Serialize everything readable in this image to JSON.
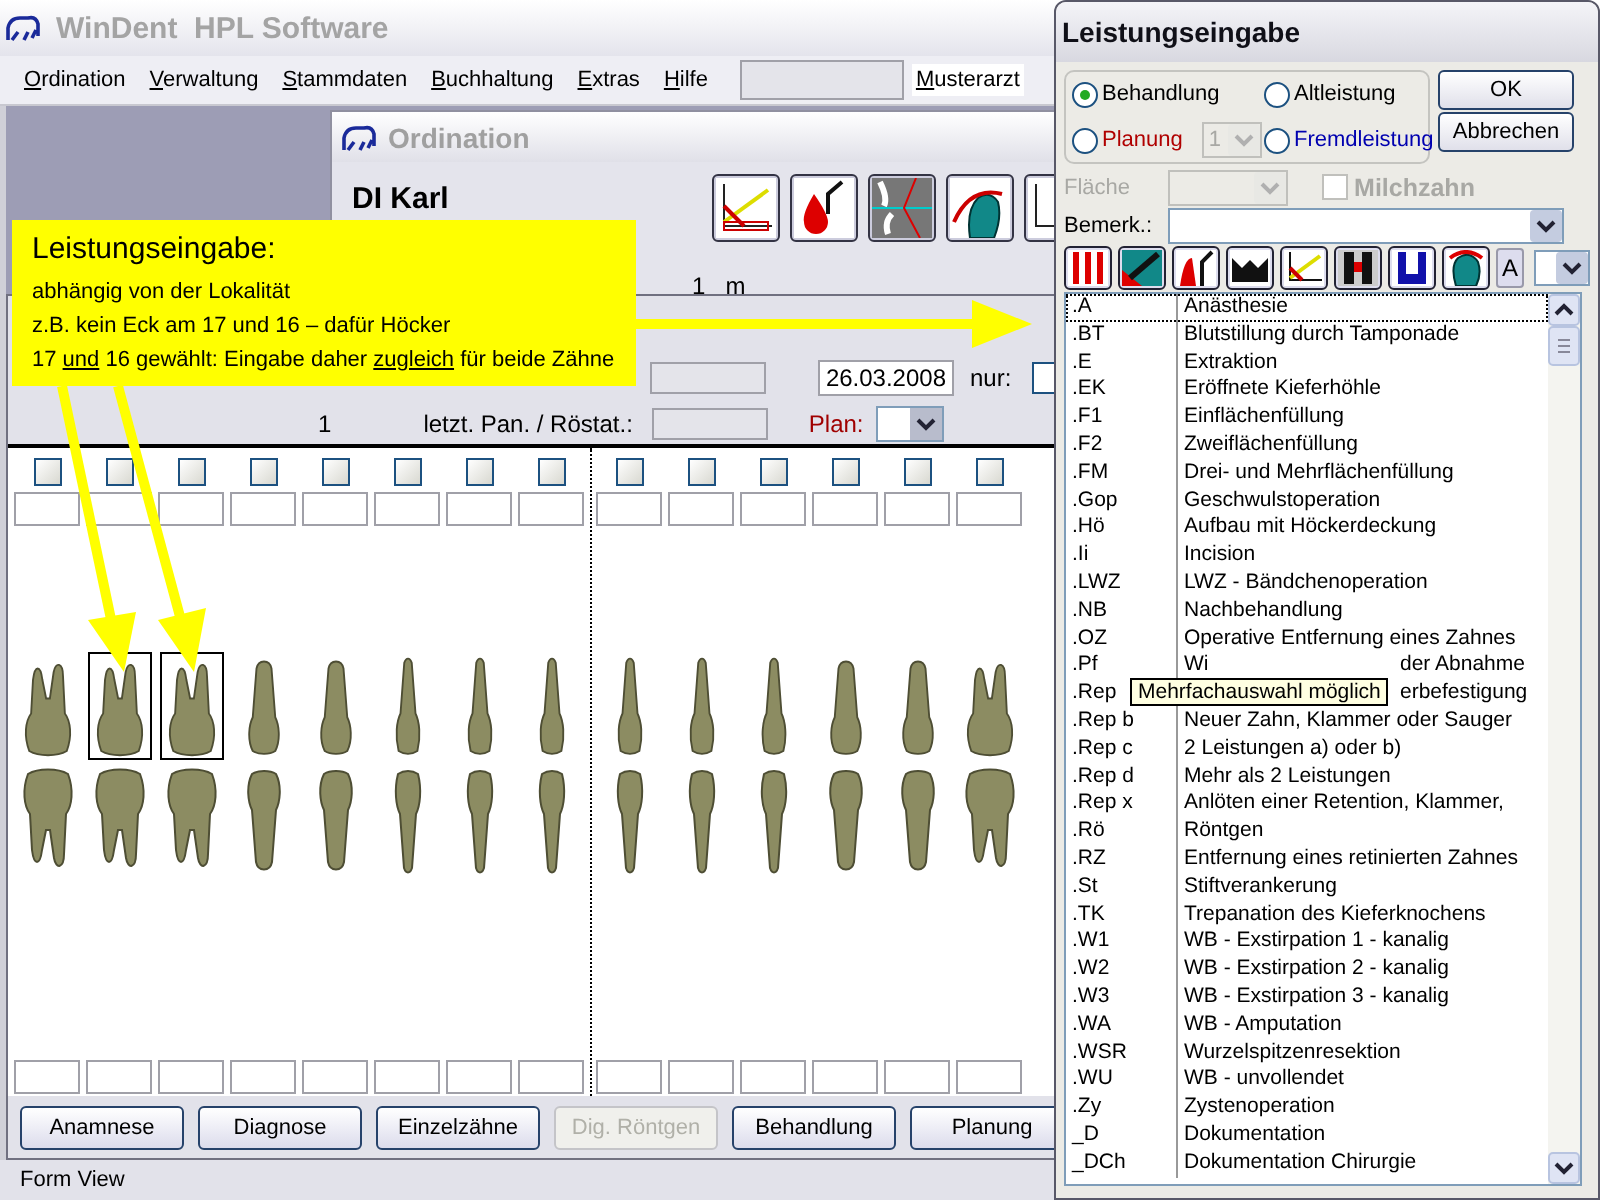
{
  "app": {
    "title": "WinDent  HPL Software",
    "menu": [
      "Ordination",
      "Verwaltung",
      "Stammdaten",
      "Buchhaltung",
      "Extras",
      "Hilfe"
    ],
    "user": "Musterarzt"
  },
  "ordination": {
    "title": "Ordination",
    "patient": "DI Karl",
    "info": [
      "1",
      "m"
    ]
  },
  "form": {
    "date": "26.03.2008",
    "only_label": "nur:",
    "count": "1",
    "xray_label": "letzt. Pan. / Röstat.:",
    "plan_label": "Plan:",
    "teeth": [
      {
        "kind": "molar",
        "selected": false,
        "checked": false
      },
      {
        "kind": "molar",
        "selected": true,
        "checked": false
      },
      {
        "kind": "molar",
        "selected": true,
        "checked": false
      },
      {
        "kind": "premolar",
        "selected": false,
        "checked": false
      },
      {
        "kind": "premolar",
        "selected": false,
        "checked": false
      },
      {
        "kind": "front",
        "selected": false,
        "checked": false
      },
      {
        "kind": "front",
        "selected": false,
        "checked": false
      },
      {
        "kind": "front",
        "selected": false,
        "checked": false
      },
      {
        "kind": "front",
        "selected": false,
        "checked": false
      },
      {
        "kind": "front",
        "selected": false,
        "checked": false
      },
      {
        "kind": "front",
        "selected": false,
        "checked": false
      },
      {
        "kind": "premolar",
        "selected": false,
        "checked": false
      },
      {
        "kind": "premolar",
        "selected": false,
        "checked": false
      },
      {
        "kind": "molar",
        "selected": false,
        "checked": false
      }
    ],
    "only_checked": false,
    "buttons": [
      {
        "label": "Anamnese",
        "disabled": false
      },
      {
        "label": "Diagnose",
        "disabled": false
      },
      {
        "label": "Einzelzähne",
        "disabled": false
      },
      {
        "label": "Dig. Röntgen",
        "disabled": true
      },
      {
        "label": "Behandlung",
        "disabled": false
      },
      {
        "label": "Planung",
        "disabled": false
      }
    ]
  },
  "note": {
    "title": "Leistungseingabe:",
    "lines": [
      [
        {
          "text": "abhängig von der Lokalität",
          "underline": false
        }
      ],
      [
        {
          "text": "z.B. kein Eck am 17 und 16 – dafür Höcker",
          "underline": false
        }
      ],
      [
        {
          "text": "17 ",
          "underline": false
        },
        {
          "text": "und",
          "underline": true
        },
        {
          "text": " 16 gewählt: Eingabe daher ",
          "underline": false
        },
        {
          "text": "zugleich",
          "underline": true
        },
        {
          "text": " für beide Zähne",
          "underline": false
        }
      ]
    ]
  },
  "dialog": {
    "title": "Leistungseingabe",
    "radios": [
      {
        "label": "Behandlung",
        "selected": true,
        "color": "#000000"
      },
      {
        "label": "Altleistung",
        "selected": false,
        "color": "#000000"
      },
      {
        "label": "Planung",
        "selected": false,
        "color": "#b00000"
      },
      {
        "label": "Fremdleistung",
        "selected": false,
        "color": "#0000b0"
      }
    ],
    "plan_number": "1",
    "ok": "OK",
    "cancel": "Abbrechen",
    "area": {
      "label": "Fläche",
      "disabled": true
    },
    "milk_tooth": {
      "label": "Milchzahn",
      "checked": false,
      "disabled": true
    },
    "remark_label": "Bemerk.:",
    "text_tool": "A",
    "services": [
      {
        "code": ".A",
        "desc": "Anästhesie",
        "focused": true
      },
      {
        "code": ".BT",
        "desc": "Blutstillung durch Tamponade",
        "focused": false
      },
      {
        "code": ".E",
        "desc": "Extraktion",
        "focused": false
      },
      {
        "code": ".EK",
        "desc": "Eröffnete Kieferhöhle",
        "focused": false
      },
      {
        "code": ".F1",
        "desc": "Einflächenfüllung",
        "focused": false
      },
      {
        "code": ".F2",
        "desc": "Zweiflächenfüllung",
        "focused": false
      },
      {
        "code": ".FM",
        "desc": "Drei- und Mehrflächenfüllung",
        "focused": false
      },
      {
        "code": ".Gop",
        "desc": "Geschwulstoperation",
        "focused": false
      },
      {
        "code": ".Hö",
        "desc": "Aufbau mit Höckerdeckung",
        "focused": false
      },
      {
        "code": ".Ii",
        "desc": "Incision",
        "focused": false
      },
      {
        "code": ".LWZ",
        "desc": "LWZ - Bändchenoperation",
        "focused": false
      },
      {
        "code": ".NB",
        "desc": "Nachbehandlung",
        "focused": false
      },
      {
        "code": ".OZ",
        "desc": "Operative Entfernung eines Zahnes",
        "focused": false
      },
      {
        "code": ".Pf",
        "desc": "Wi",
        "desc_tail": "der Abnahme",
        "focused": false
      },
      {
        "code": ".Rep",
        "desc_tail": "erbefestigung",
        "focused": false
      },
      {
        "code": ".Rep b",
        "desc": "Neuer Zahn, Klammer oder Sauger",
        "focused": false
      },
      {
        "code": ".Rep c",
        "desc": "2  Leistungen a) oder b)",
        "focused": false
      },
      {
        "code": ".Rep d",
        "desc": "Mehr als 2 Leistungen",
        "focused": false
      },
      {
        "code": ".Rep x",
        "desc": "Anlöten einer Retention, Klammer,",
        "focused": false
      },
      {
        "code": ".Rö",
        "desc": "Röntgen",
        "focused": false
      },
      {
        "code": ".RZ",
        "desc": "Entfernung eines retinierten Zahnes",
        "focused": false
      },
      {
        "code": ".St",
        "desc": "Stiftverankerung",
        "focused": false
      },
      {
        "code": ".TK",
        "desc": "Trepanation des Kieferknochens",
        "focused": false
      },
      {
        "code": ".W1",
        "desc": "WB - Exstirpation 1 - kanalig",
        "focused": false
      },
      {
        "code": ".W2",
        "desc": "WB - Exstirpation 2 - kanalig",
        "focused": false
      },
      {
        "code": ".W3",
        "desc": "WB - Exstirpation 3 - kanalig",
        "focused": false
      },
      {
        "code": ".WA",
        "desc": "WB - Amputation",
        "focused": false
      },
      {
        "code": ".WSR",
        "desc": "Wurzelspitzenresektion",
        "focused": false
      },
      {
        "code": ".WU",
        "desc": "WB - unvollendet",
        "focused": false
      },
      {
        "code": ".Zy",
        "desc": "Zystenoperation",
        "focused": false
      },
      {
        "code": "_D",
        "desc": "Dokumentation",
        "focused": false
      },
      {
        "code": "_DCh",
        "desc": "Dokumentation Chirurgie",
        "focused": false
      }
    ]
  },
  "tooltip": "Mehrfachauswahl möglich",
  "status_bar": "Form View"
}
